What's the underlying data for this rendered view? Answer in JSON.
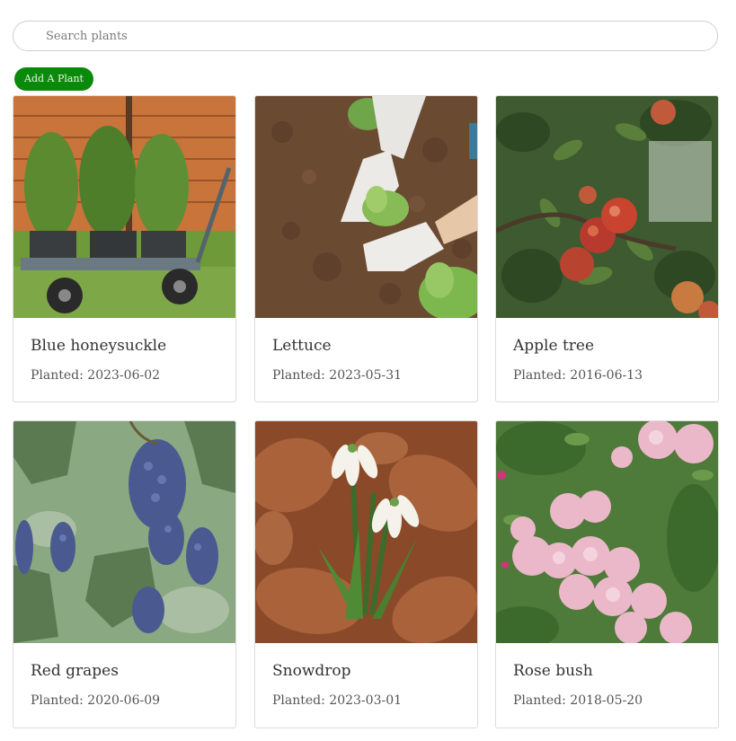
{
  "search": {
    "placeholder": "Search plants",
    "value": ""
  },
  "actions": {
    "add_label": "Add A Plant"
  },
  "plants": [
    {
      "name": "Blue honeysuckle",
      "planted": "Planted: 2023-06-02",
      "image": "potted-shrubs-on-cart-photo"
    },
    {
      "name": "Lettuce",
      "planted": "Planted: 2023-05-31",
      "image": "lettuce-seedlings-gloved-hands-photo"
    },
    {
      "name": "Apple tree",
      "planted": "Planted: 2016-06-13",
      "image": "apples-on-branch-photo"
    },
    {
      "name": "Red grapes",
      "planted": "Planted: 2020-06-09",
      "image": "grape-clusters-photo"
    },
    {
      "name": "Snowdrop",
      "planted": "Planted: 2023-03-01",
      "image": "snowdrop-flowers-photo"
    },
    {
      "name": "Rose bush",
      "planted": "Planted: 2018-05-20",
      "image": "pink-rose-bush-photo"
    }
  ],
  "colors": {
    "button_bg": "#0a8a0a",
    "border": "#dcdcdc",
    "text": "#333333"
  }
}
